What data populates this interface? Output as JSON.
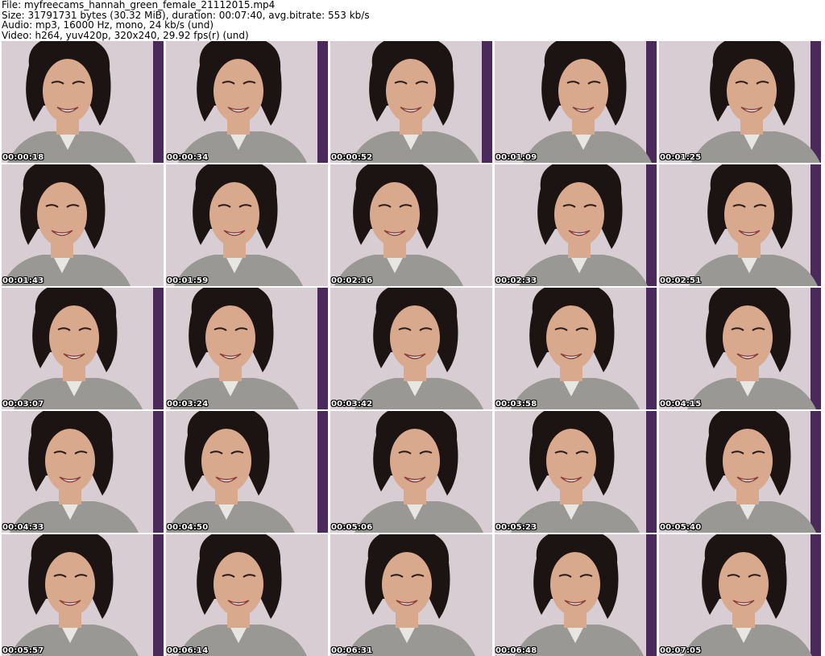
{
  "header": {
    "file": "File: myfreecams_hannah_green_female_21112015.mp4",
    "size": "Size: 31791731 bytes (30.32 MiB), duration: 00:07:40, avg.bitrate: 553 kb/s",
    "audio": "Audio: mp3, 16000 Hz, mono, 24 kb/s (und)",
    "video": "Video: h264, yuv420p, 320x240, 29.92 fps(r) (und)"
  },
  "frames": [
    {
      "time": "00:00:18"
    },
    {
      "time": "00:00:34"
    },
    {
      "time": "00:00:52"
    },
    {
      "time": "00:01:09"
    },
    {
      "time": "00:01:25"
    },
    {
      "time": "00:01:43"
    },
    {
      "time": "00:01:59"
    },
    {
      "time": "00:02:16"
    },
    {
      "time": "00:02:33"
    },
    {
      "time": "00:02:51"
    },
    {
      "time": "00:03:07"
    },
    {
      "time": "00:03:24"
    },
    {
      "time": "00:03:42"
    },
    {
      "time": "00:03:58"
    },
    {
      "time": "00:04:15"
    },
    {
      "time": "00:04:33"
    },
    {
      "time": "00:04:50"
    },
    {
      "time": "00:05:06"
    },
    {
      "time": "00:05:23"
    },
    {
      "time": "00:05:40"
    },
    {
      "time": "00:05:57"
    },
    {
      "time": "00:06:14"
    },
    {
      "time": "00:06:31"
    },
    {
      "time": "00:06:48"
    },
    {
      "time": "00:07:05"
    }
  ],
  "colors": {
    "background_wall": "#d8cdd3",
    "purple_wall": "#4a2a5a",
    "hair": "#1c1412",
    "skin": "#d9a98e",
    "shirt": "#9a9894",
    "timestamp": "#ffffff"
  }
}
